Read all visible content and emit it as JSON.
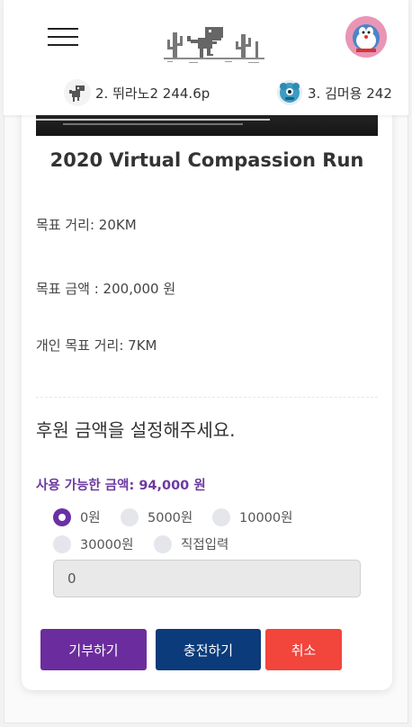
{
  "header": {
    "rankings": [
      {
        "label": "2. 뛰라노2 244.6p",
        "icon": "dino-icon"
      },
      {
        "label": "3. 김머용 242",
        "icon": "blue-monster-icon"
      }
    ],
    "avatar_icon": "doraemon-avatar"
  },
  "event": {
    "title": "2020 Virtual Compassion Run",
    "goal_distance": "목표 거리: 20KM",
    "goal_amount": "목표 금액 : 200,000 원",
    "personal_goal": "개인 목표 거리: 7KM"
  },
  "donation": {
    "prompt": "후원 금액을 설정해주세요.",
    "balance_label": "사용 가능한 금액: 94,000 원",
    "options": [
      "0원",
      "5000원",
      "10000원",
      "30000원",
      "직접입력"
    ],
    "selected_index": 0,
    "input_value": "0"
  },
  "buttons": {
    "donate": "기부하기",
    "charge": "충전하기",
    "cancel": "취소"
  },
  "colors": {
    "primary_purple": "#6b2d9e",
    "navy": "#0b3b7a",
    "cancel_red": "#f2453c",
    "balance_text": "#6c3aa0"
  }
}
